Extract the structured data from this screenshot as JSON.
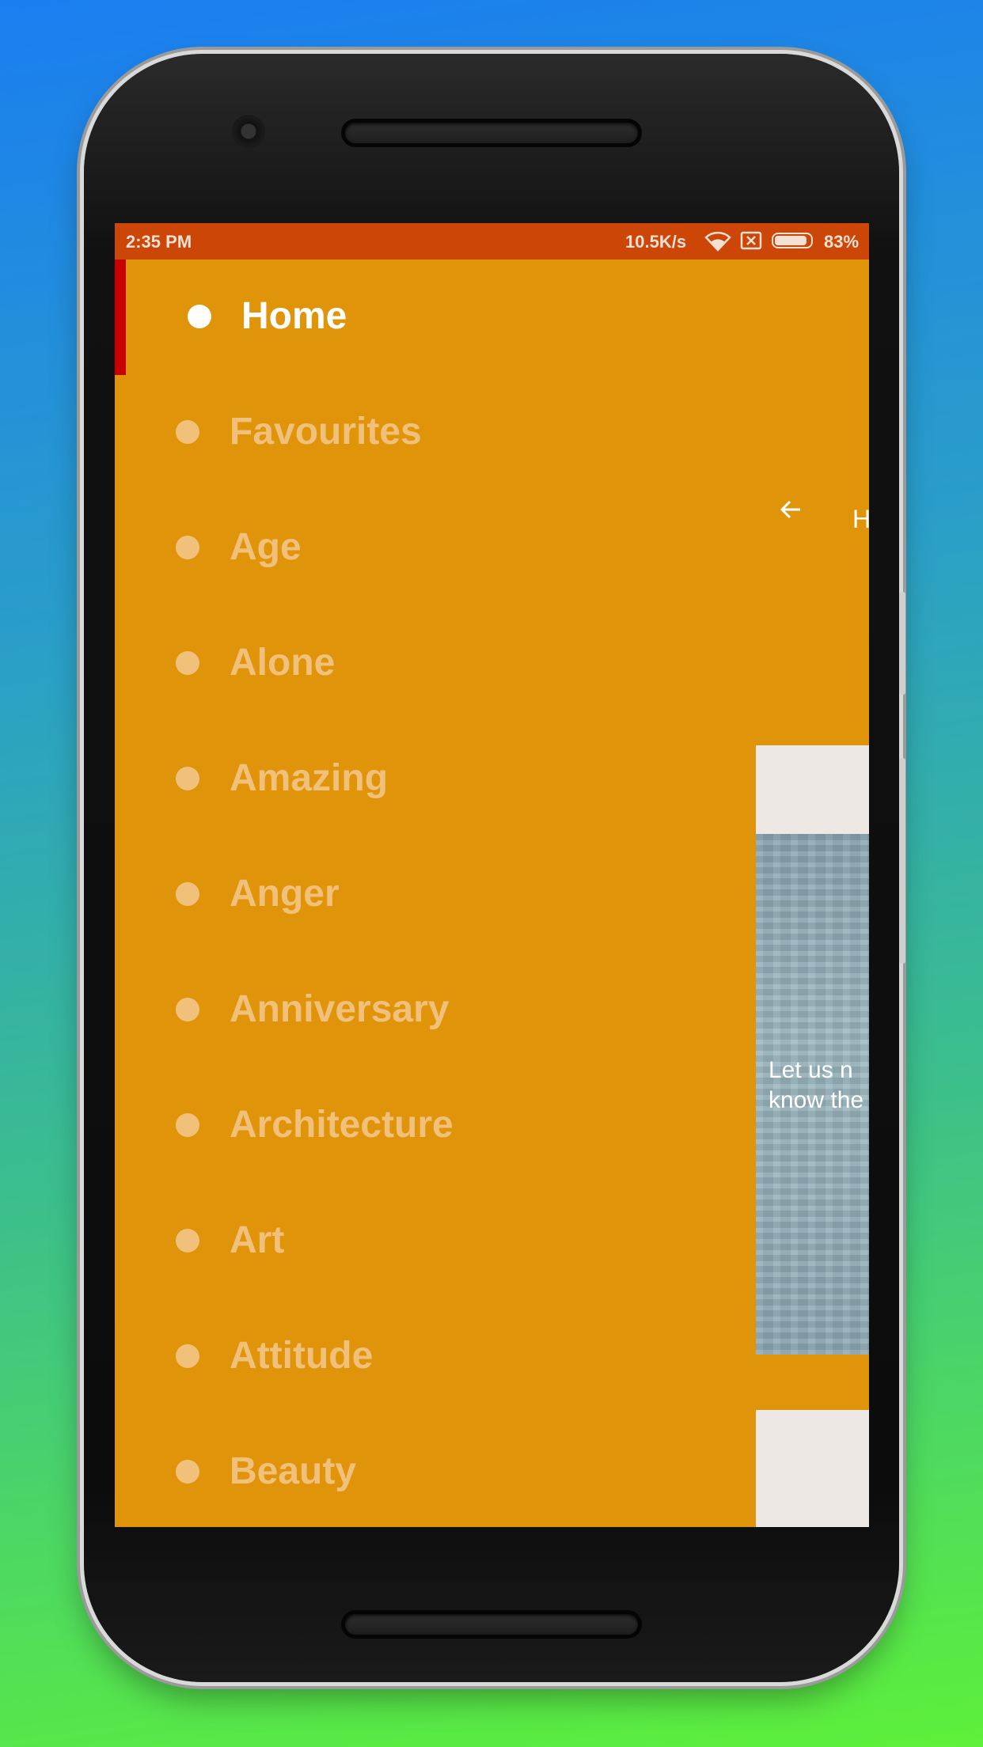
{
  "status_bar": {
    "time": "2:35 PM",
    "network_speed": "10.5K/s",
    "battery_percent": "83%",
    "icons": [
      "wifi-icon",
      "no-sim-icon",
      "battery-icon"
    ]
  },
  "drawer": {
    "items": [
      {
        "label": "Home",
        "active": true
      },
      {
        "label": "Favourites",
        "active": false
      },
      {
        "label": "Age",
        "active": false
      },
      {
        "label": "Alone",
        "active": false
      },
      {
        "label": "Amazing",
        "active": false
      },
      {
        "label": "Anger",
        "active": false
      },
      {
        "label": "Anniversary",
        "active": false
      },
      {
        "label": "Architecture",
        "active": false
      },
      {
        "label": "Art",
        "active": false
      },
      {
        "label": "Attitude",
        "active": false
      },
      {
        "label": "Beauty",
        "active": false
      }
    ]
  },
  "background_screen": {
    "toolbar_title": "H",
    "quote_line_1": "Let us n",
    "quote_line_2": "know the"
  },
  "colors": {
    "accent": "#e0940a",
    "status_bar": "#cc4607",
    "active_indicator": "#c80000",
    "inactive_text": "#f1c07a"
  }
}
